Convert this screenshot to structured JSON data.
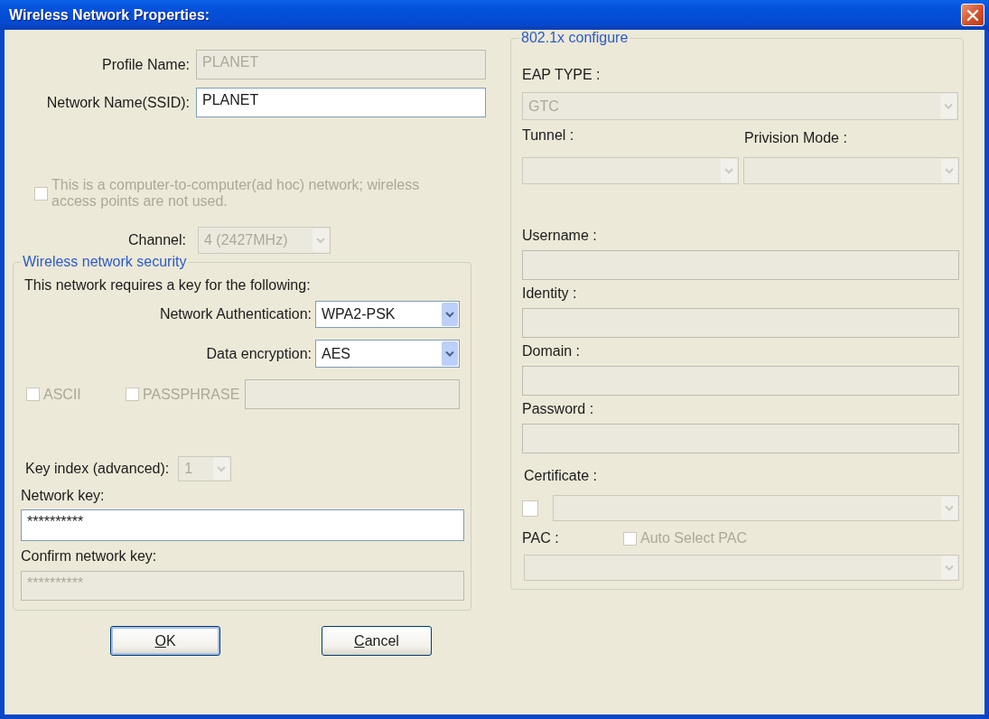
{
  "window": {
    "title": "Wireless Network Properties:"
  },
  "general": {
    "profile_name": {
      "label": "Profile Name:",
      "value": "PLANET",
      "disabled": true
    },
    "network_name": {
      "label": "Network Name(SSID):",
      "value": "PLANET",
      "disabled": false
    },
    "ad_hoc": {
      "label": "This is a computer-to-computer(ad hoc) network; wireless access points are not used.",
      "checked": false,
      "disabled": true
    },
    "channel": {
      "label": "Channel:",
      "value": "4 (2427MHz)",
      "disabled": true
    }
  },
  "security": {
    "title": "Wireless network security",
    "intro": "This network requires a key for the following:",
    "authentication": {
      "label": "Network Authentication:",
      "value": "WPA2-PSK",
      "disabled": false
    },
    "encryption": {
      "label": "Data encryption:",
      "value": "AES",
      "disabled": false
    },
    "ascii": {
      "label": "ASCII",
      "checked": false,
      "disabled": true
    },
    "passphrase": {
      "label": "PASSPHRASE",
      "checked": false,
      "disabled": true,
      "field_disabled": true
    },
    "key_index": {
      "label": "Key index (advanced):",
      "value": "1",
      "disabled": true
    },
    "network_key": {
      "label": "Network key:",
      "value": "**********",
      "disabled": false
    },
    "confirm_key": {
      "label": "Confirm network key:",
      "value": "**********",
      "disabled": true
    }
  },
  "eap": {
    "title": "802.1x configure",
    "eap_type": {
      "label": "EAP TYPE :",
      "value": "GTC",
      "disabled": true
    },
    "tunnel": {
      "label": "Tunnel :",
      "disabled": true
    },
    "provision_mode": {
      "label": "Privision Mode :",
      "disabled": true
    },
    "text_fields": [
      {
        "label": "Username :",
        "disabled": true
      },
      {
        "label": "Identity :",
        "disabled": true
      },
      {
        "label": "Domain :",
        "disabled": true
      },
      {
        "label": "Password :",
        "disabled": true
      }
    ],
    "certificate": {
      "label": "Certificate :",
      "checked": false,
      "disabled": true,
      "select_disabled": true
    },
    "pac": {
      "label": "PAC :",
      "auto_select": {
        "label": "Auto Select PAC",
        "checked": false,
        "disabled": true
      },
      "select_disabled": true
    }
  },
  "buttons": [
    {
      "label": "OK",
      "default": true,
      "access_key_underlined": true
    },
    {
      "label": "Cancel",
      "default": false,
      "access_key_underlined": true
    }
  ]
}
